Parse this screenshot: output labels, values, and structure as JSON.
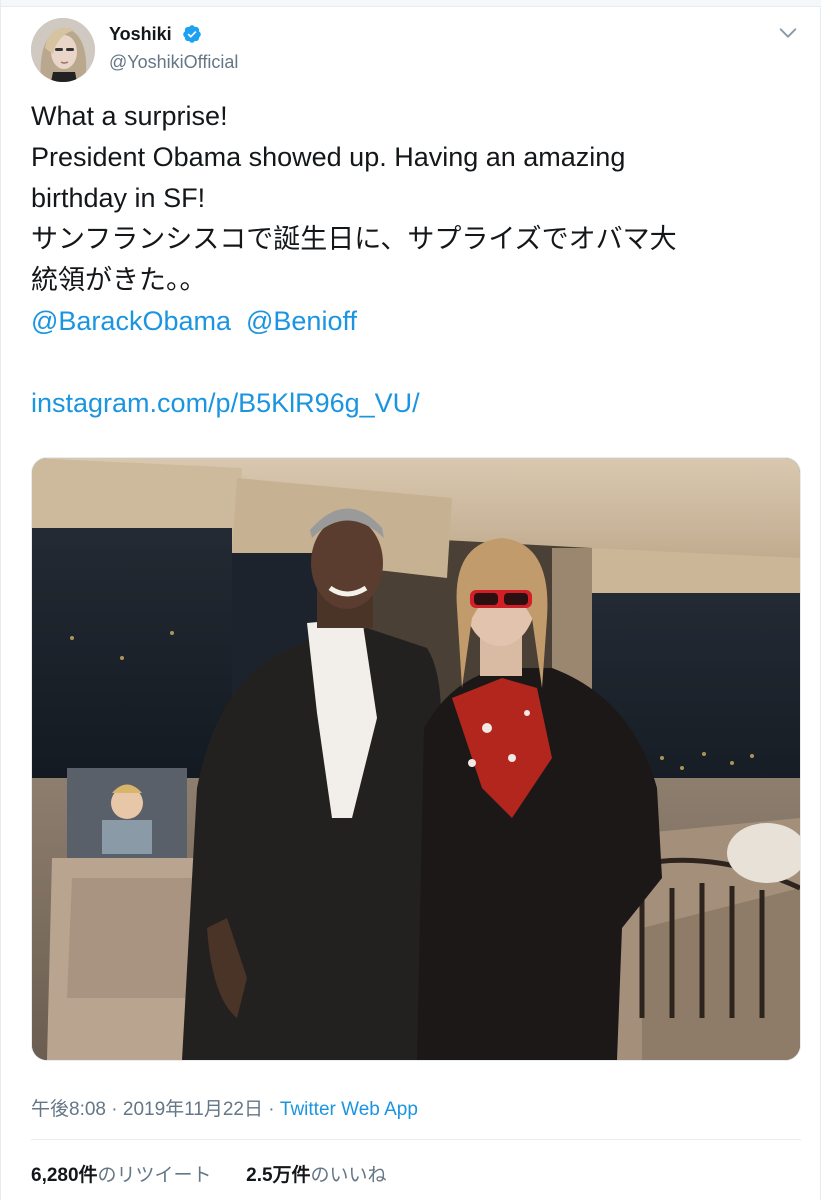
{
  "author": {
    "name": "Yoshiki",
    "handle": "@YoshikiOfficial",
    "verified": true
  },
  "tweet": {
    "lines": [
      "What a surprise!",
      "President Obama showed up. Having an amazing",
      "birthday in SF!",
      "サンフランシスコで誕生日に、サプライズでオバマ大",
      "統領がきた。。"
    ],
    "mentions": [
      "@BarackObama",
      "@Benioff"
    ],
    "link": "instagram.com/p/B5KlR96g_VU/"
  },
  "meta": {
    "time": "午後8:08",
    "separator": "·",
    "date": "2019年11月22日",
    "source": "Twitter Web App"
  },
  "stats": {
    "retweets_count": "6,280件",
    "retweets_label": "のリツイート",
    "likes_count": "2.5万件",
    "likes_label": "のいいね"
  },
  "icons": {
    "verified": "verified-badge-icon",
    "menu": "chevron-down-icon"
  },
  "colors": {
    "link": "#1b95e0",
    "secondary_text": "#657786",
    "primary_text": "#14171a",
    "divider": "#e6ecf0"
  }
}
